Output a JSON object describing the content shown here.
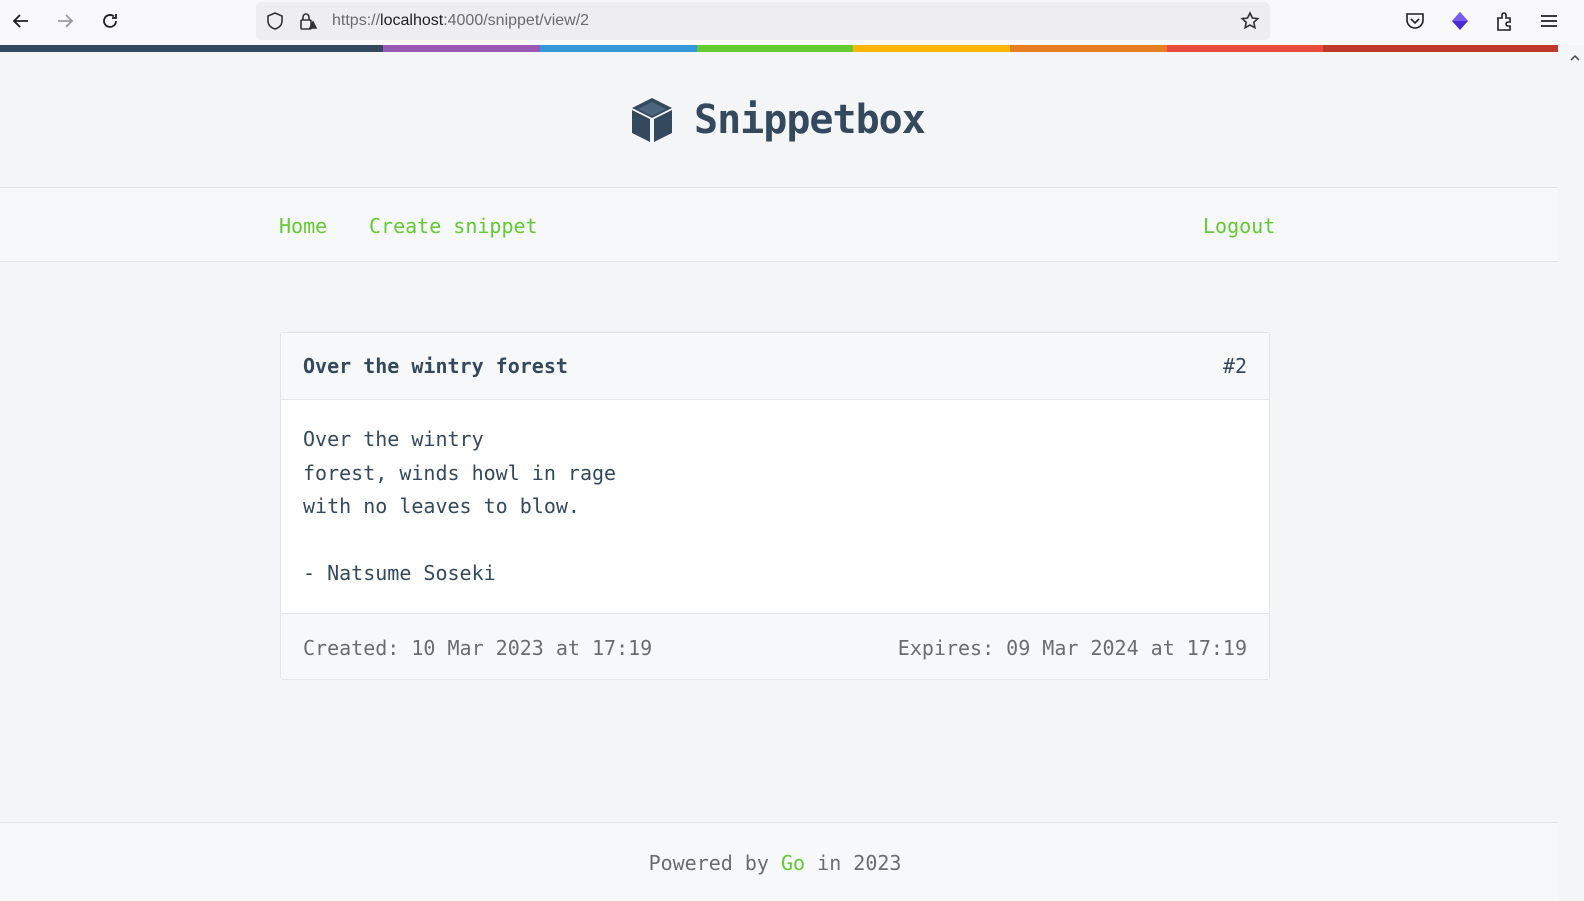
{
  "browser": {
    "url_scheme": "https://",
    "url_host": "localhost",
    "url_path": ":4000/snippet/view/2"
  },
  "stripe_colors": [
    "#34495e",
    "#9b59b6",
    "#3498db",
    "#62cb31",
    "#ffb606",
    "#e67e22",
    "#e74c3c",
    "#c0392b"
  ],
  "header": {
    "title": "Snippetbox"
  },
  "nav": {
    "home": "Home",
    "create": "Create snippet",
    "logout": "Logout"
  },
  "snippet": {
    "title": "Over the wintry forest",
    "id": "#2",
    "content": "Over the wintry\nforest, winds howl in rage\nwith no leaves to blow.\n\n- Natsume Soseki",
    "created": "Created: 10 Mar 2023 at 17:19",
    "expires": "Expires: 09 Mar 2024 at 17:19"
  },
  "footer": {
    "prefix": "Powered by ",
    "link": "Go",
    "suffix": " in 2023"
  },
  "colors": {
    "accent": "#62cb31",
    "text": "#34495e"
  }
}
